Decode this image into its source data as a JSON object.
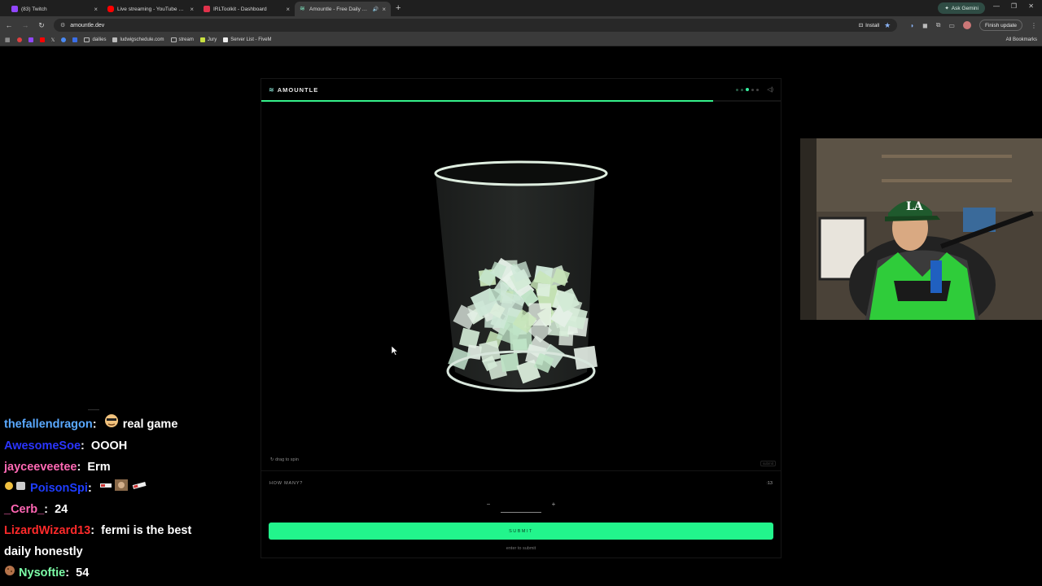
{
  "browser": {
    "tabs": [
      {
        "title": "(83) Twitch",
        "favicon_color": "#9146ff",
        "active": false
      },
      {
        "title": "Live streaming - YouTube Studio",
        "favicon_color": "#ff0000",
        "active": false
      },
      {
        "title": "IRLToolkit - Dashboard",
        "favicon_color": "#e0324b",
        "active": false
      },
      {
        "title": "Amountle - Free Daily Visu...",
        "favicon_color": "#7fe6c0",
        "active": true
      }
    ],
    "gemini_label": "Ask Gemini",
    "url": "amountle.dev",
    "install_label": "Install",
    "finish_update_label": "Finish update",
    "bookmarks": [
      {
        "label": "dailies",
        "type": "folder"
      },
      {
        "label": "ludwigschedule.com",
        "type": "site"
      },
      {
        "label": "stream",
        "type": "folder"
      },
      {
        "label": "Jury",
        "type": "site"
      },
      {
        "label": "Server List - FiveM",
        "type": "site"
      }
    ],
    "all_bookmarks_label": "All Bookmarks"
  },
  "game": {
    "logo": "AMOUNTLE",
    "progress": 0.87,
    "drag_hint": "drag to spin",
    "submit_hint_small": "submit",
    "question": "HOW MANY?",
    "timer": ":13",
    "answer_value": "",
    "submit_label": "SUBMIT",
    "enter_hint": "enter to submit"
  },
  "chat": [
    {
      "user": "thefallendragon",
      "color": "#5aa9ff",
      "badge": "",
      "emote_before": true,
      "text": "real game"
    },
    {
      "user": "AwesomeSoe",
      "color": "#2a35ff",
      "badge": "",
      "emote_before": false,
      "text": "OOOH"
    },
    {
      "user": "jayceeveetee",
      "color": "#ff69b4",
      "badge": "",
      "emote_before": false,
      "text": "Erm"
    },
    {
      "user": "PoisonSpi",
      "color": "#1f3dff",
      "badge": "badges",
      "emote_before": false,
      "text": ""
    },
    {
      "user": "_Cerb_",
      "color": "#ff66b3",
      "badge": "",
      "emote_before": false,
      "text": "24"
    },
    {
      "user": "LizardWizard13",
      "color": "#ff2a2a",
      "badge": "",
      "emote_before": false,
      "text": "fermi is the best"
    },
    {
      "user": "",
      "color": "#ffffff",
      "badge": "",
      "emote_before": false,
      "text": "daily honestly"
    },
    {
      "user": "Nysoftie",
      "color": "#7dffa8",
      "badge": "cookie",
      "emote_before": false,
      "text": "54"
    }
  ]
}
